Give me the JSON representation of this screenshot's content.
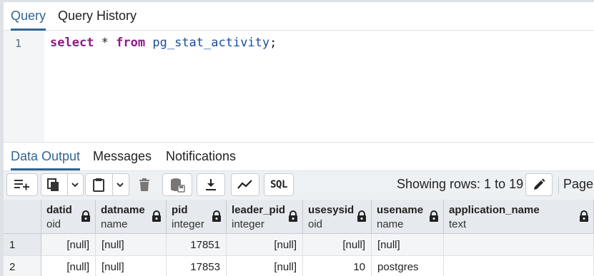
{
  "query_tabs": [
    {
      "label": "Query",
      "active": true
    },
    {
      "label": "Query History",
      "active": false
    }
  ],
  "editor": {
    "line_number": "1",
    "sql": {
      "kw_select": "select",
      "star": "*",
      "kw_from": "from",
      "table": "pg_stat_activity",
      "semicolon": ";"
    }
  },
  "output_tabs": [
    {
      "label": "Data Output",
      "active": true
    },
    {
      "label": "Messages",
      "active": false
    },
    {
      "label": "Notifications",
      "active": false
    }
  ],
  "toolbar": {
    "sql_label": "SQL",
    "showing_rows": "Showing rows: 1 to 19",
    "page_label": "Page"
  },
  "grid": {
    "columns": [
      {
        "name": "datid",
        "type": "oid"
      },
      {
        "name": "datname",
        "type": "name"
      },
      {
        "name": "pid",
        "type": "integer"
      },
      {
        "name": "leader_pid",
        "type": "integer"
      },
      {
        "name": "usesysid",
        "type": "oid"
      },
      {
        "name": "usename",
        "type": "name"
      },
      {
        "name": "application_name",
        "type": "text"
      }
    ],
    "rows": [
      {
        "num": "1",
        "cells": [
          "[null]",
          "[null]",
          "17851",
          "[null]",
          "[null]",
          "[null]",
          ""
        ]
      },
      {
        "num": "2",
        "cells": [
          "[null]",
          "[null]",
          "17853",
          "[null]",
          "10",
          "postgres",
          ""
        ]
      }
    ]
  },
  "colors": {
    "accent": "#326690",
    "keyword": "#8a1d86",
    "identifier": "#1a4d9c"
  }
}
